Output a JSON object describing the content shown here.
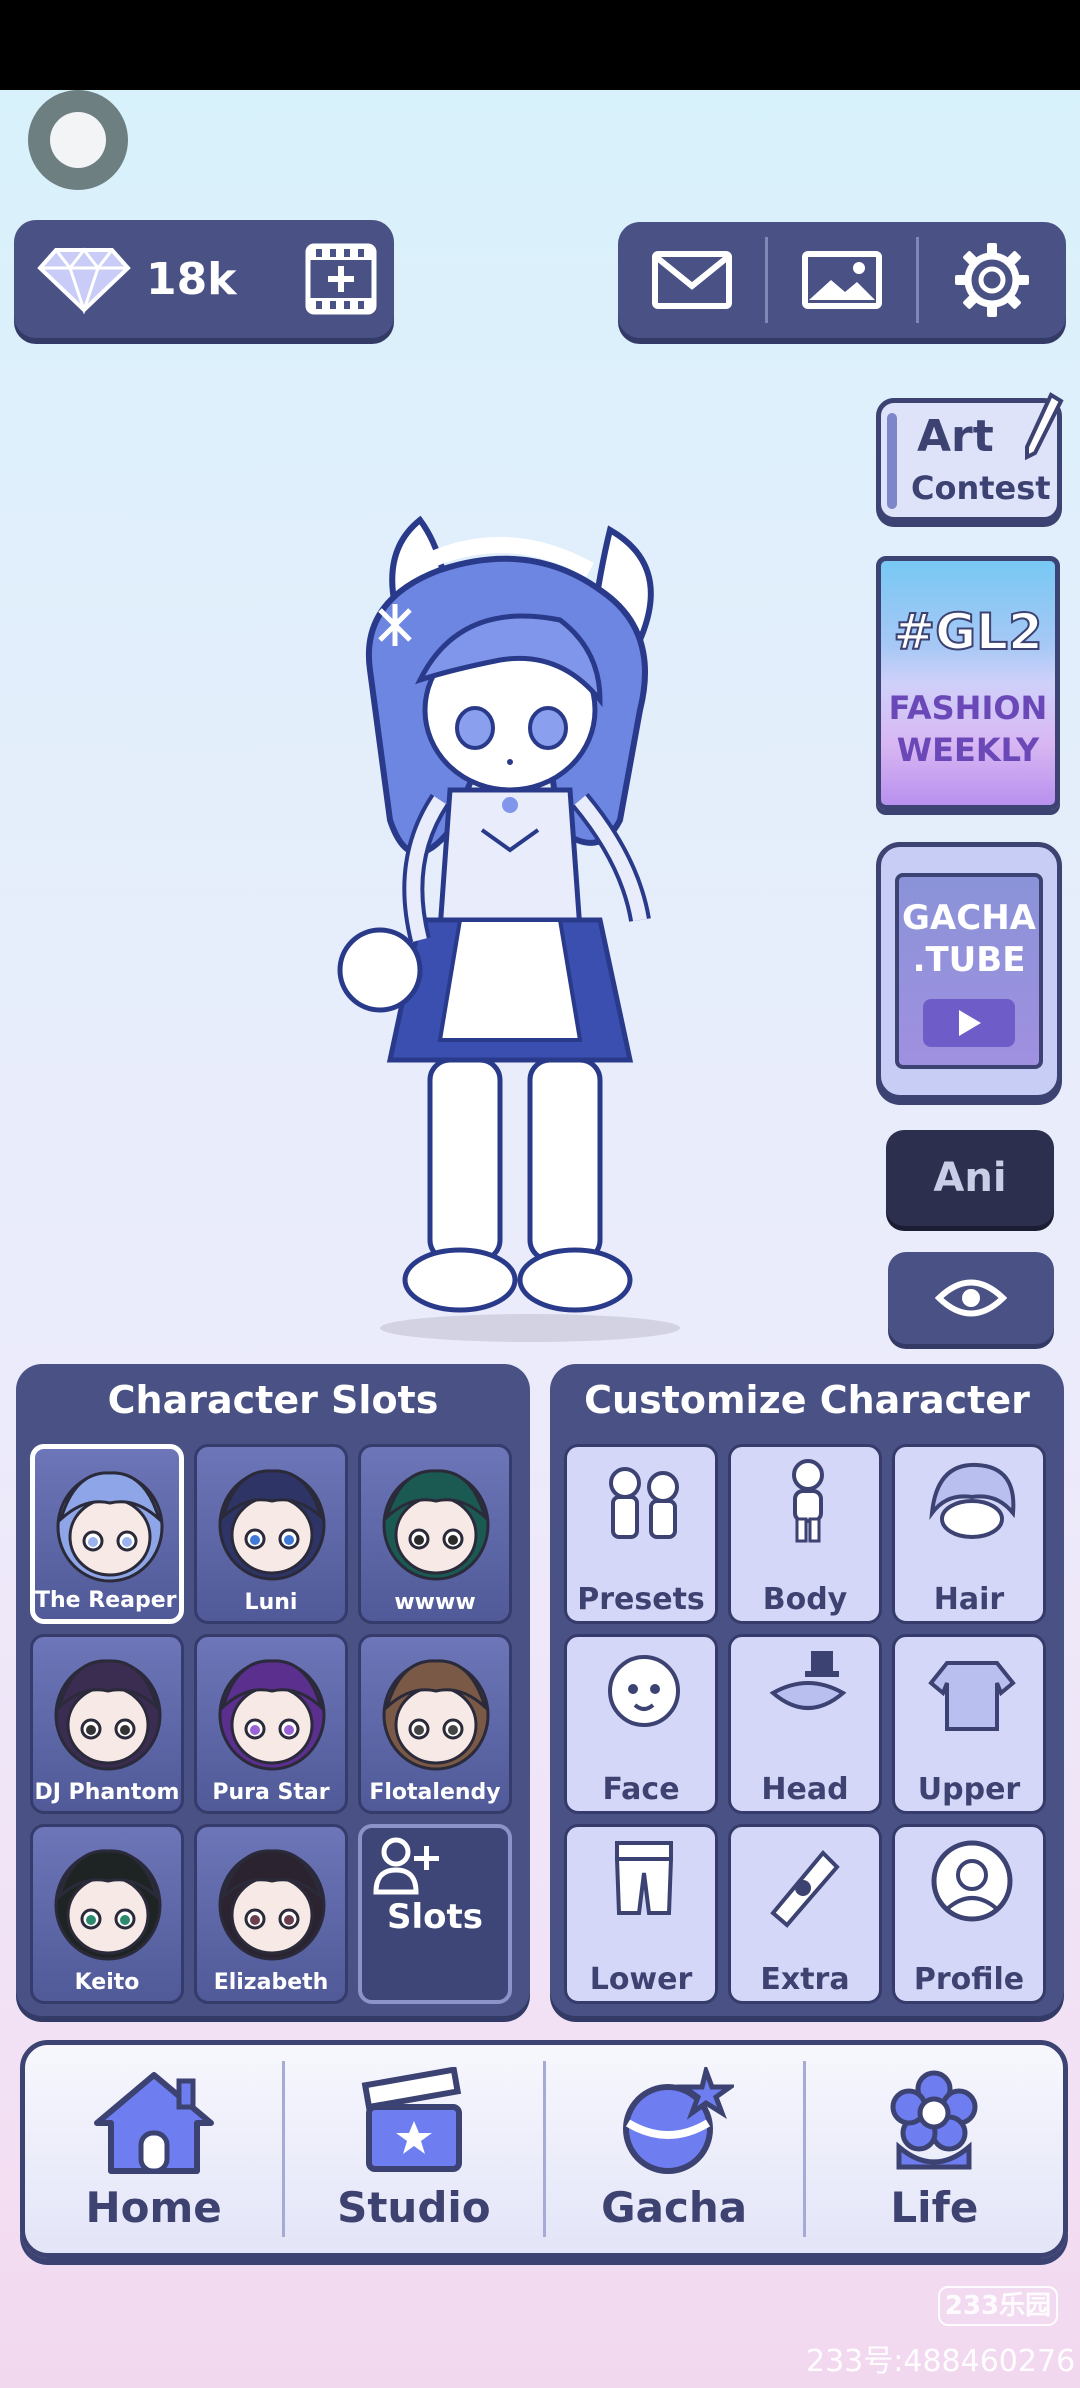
{
  "top_bar": {
    "gem_count": "18k"
  },
  "side_buttons": {
    "art_contest_line1": "Art",
    "art_contest_line2": "Contest",
    "gl2_title": "#GL2",
    "gl2_line1": "FASHION",
    "gl2_line2": "WEEKLY",
    "gacha_tube_line1": "GACHA",
    "gacha_tube_line2": ".TUBE",
    "ani_label": "Ani"
  },
  "character_slots": {
    "title": "Character Slots",
    "slots": [
      {
        "label": "The Reaper Bo",
        "hair": "#8ea6e8",
        "eyes": "#9bb4f0"
      },
      {
        "label": "Luni",
        "hair": "#2e3566",
        "eyes": "#3f7ad8"
      },
      {
        "label": "wwww",
        "hair": "#1b5a52",
        "eyes": "#2a2a2a"
      },
      {
        "label": "DJ Phantom",
        "hair": "#3b2c52",
        "eyes": "#333333"
      },
      {
        "label": "Pura Star",
        "hair": "#5b2f8e",
        "eyes": "#9a63d6"
      },
      {
        "label": "Flotalendy",
        "hair": "#7a5a46",
        "eyes": "#444444"
      },
      {
        "label": "Keito",
        "hair": "#1e2424",
        "eyes": "#2e8a6e"
      },
      {
        "label": "Elizabeth",
        "hair": "#2b2430",
        "eyes": "#6b3e4e"
      }
    ],
    "add_label": "Slots"
  },
  "customize": {
    "title": "Customize Character",
    "items": [
      {
        "label": "Presets",
        "icon": "presets-icon"
      },
      {
        "label": "Body",
        "icon": "body-icon"
      },
      {
        "label": "Hair",
        "icon": "hair-icon"
      },
      {
        "label": "Face",
        "icon": "face-icon"
      },
      {
        "label": "Head",
        "icon": "head-accessory-icon"
      },
      {
        "label": "Upper",
        "icon": "upper-clothing-icon"
      },
      {
        "label": "Lower",
        "icon": "lower-clothing-icon"
      },
      {
        "label": "Extra",
        "icon": "extra-icon"
      },
      {
        "label": "Profile",
        "icon": "profile-icon"
      }
    ]
  },
  "bottom_nav": [
    {
      "label": "Home",
      "icon": "home-icon"
    },
    {
      "label": "Studio",
      "icon": "clapperboard-icon"
    },
    {
      "label": "Gacha",
      "icon": "gacha-ball-icon"
    },
    {
      "label": "Life",
      "icon": "flower-icon"
    }
  ],
  "watermark": {
    "logo": "233乐园",
    "id": "233号:488460276"
  },
  "colors": {
    "panel": "#4a5184",
    "panel_shadow": "#343a66",
    "outline": "#3c4272",
    "tile_light": "#d4d7f7"
  }
}
